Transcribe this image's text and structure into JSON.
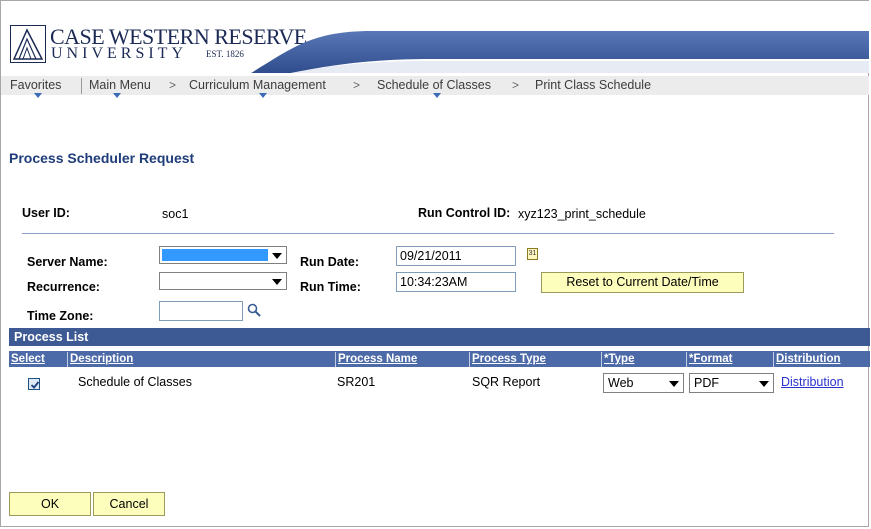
{
  "branding": {
    "name": "CASE WESTERN RESERVE",
    "university": "UNIVERSITY",
    "est": "EST. 1826",
    "navy": "#1b2a55",
    "swoosh_color": "#3b5a9e"
  },
  "nav": {
    "favorites": "Favorites",
    "main_menu": "Main Menu",
    "curriculum": "Curriculum Management",
    "schedule": "Schedule of Classes",
    "print": "Print Class Schedule",
    "separator": ">"
  },
  "page": {
    "title": "Process Scheduler Request"
  },
  "form": {
    "user_id_label": "User ID:",
    "user_id_value": "soc1",
    "run_control_label": "Run Control ID:",
    "run_control_value": "xyz123_print_schedule",
    "server_name_label": "Server Name:",
    "run_date_label": "Run Date:",
    "run_date_value": "09/21/2011",
    "recurrence_label": "Recurrence:",
    "run_time_label": "Run Time:",
    "run_time_value": "10:34:23AM",
    "reset_button": "Reset to Current Date/Time",
    "time_zone_label": "Time Zone:",
    "calendar_glyph": "31"
  },
  "process_list": {
    "title": "Process List",
    "columns": [
      "Select",
      "Description",
      "Process Name",
      "Process Type",
      "*Type",
      "*Format",
      "Distribution"
    ],
    "rows": [
      {
        "selected": true,
        "description": "Schedule of Classes",
        "process_name": "SR201",
        "process_type": "SQR Report",
        "type": "Web",
        "format": "PDF",
        "distribution": "Distribution"
      }
    ],
    "header_color": "#3d5a94"
  },
  "footer": {
    "ok": "OK",
    "cancel": "Cancel"
  }
}
